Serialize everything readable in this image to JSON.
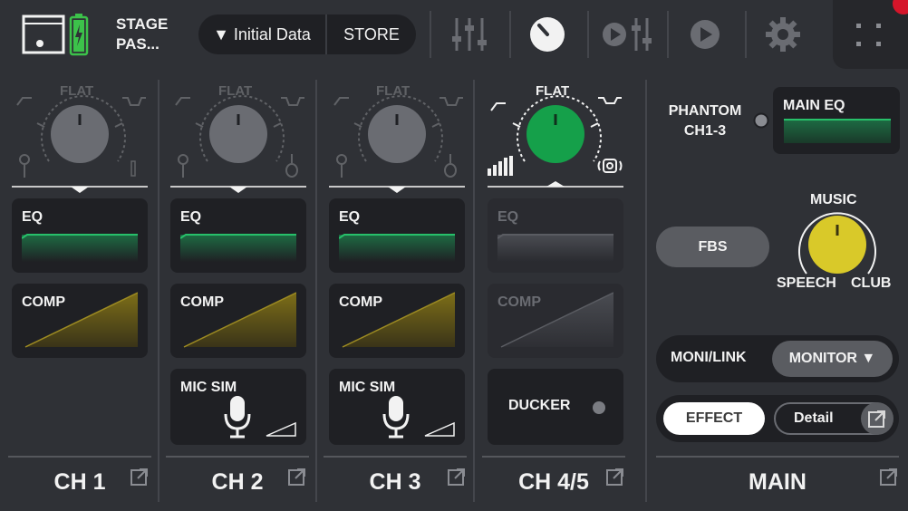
{
  "topbar": {
    "scene_name": "STAGE PAS...",
    "scene_recall_label": "▼ Initial Data",
    "store_label": "STORE",
    "icons": [
      "stage-pas-icon",
      "battery-icon",
      "fader-icon",
      "knob-icon",
      "playback-mix-icon",
      "play-icon",
      "gear-icon",
      "menu-icon"
    ]
  },
  "channels": [
    {
      "name": "CH 1",
      "flat_label": "FLAT",
      "eq_label": "EQ",
      "comp_label": "COMP",
      "has_mic_sim": false
    },
    {
      "name": "CH 2",
      "flat_label": "FLAT",
      "eq_label": "EQ",
      "comp_label": "COMP",
      "mic_sim_label": "MIC SIM",
      "has_mic_sim": true
    },
    {
      "name": "CH 3",
      "flat_label": "FLAT",
      "eq_label": "EQ",
      "comp_label": "COMP",
      "mic_sim_label": "MIC SIM",
      "has_mic_sim": true
    },
    {
      "name": "CH 4/5",
      "flat_label": "FLAT",
      "eq_label": "EQ",
      "comp_label": "COMP",
      "ducker_label": "DUCKER"
    }
  ],
  "main": {
    "name": "MAIN",
    "phantom_label": "PHANTOM CH1-3",
    "main_eq_label": "MAIN EQ",
    "fbs_label": "FBS",
    "music_label": "MUSIC",
    "speech_label": "SPEECH",
    "club_label": "CLUB",
    "moni_link_label": "MONI/LINK",
    "monitor_select": "MONITOR ▼",
    "effect_label": "EFFECT",
    "detail_label": "Detail"
  },
  "colors": {
    "background": "#2f3136",
    "panel": "#1f2024",
    "eq_green": "#1fa85a",
    "comp_yellow": "#8a7a1c",
    "ch45_knob": "#15a04a",
    "main_knob": "#d9c929",
    "battery": "#3cc24a"
  }
}
